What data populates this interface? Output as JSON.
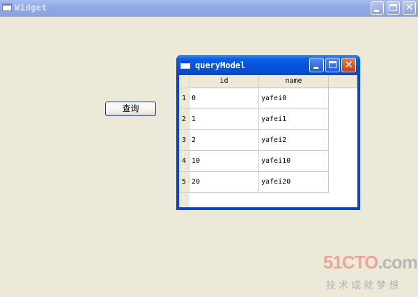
{
  "main_window": {
    "title": "Widget",
    "buttons": {
      "minimize": "",
      "maximize": "",
      "close": "✕"
    }
  },
  "query_button": {
    "label": "查询"
  },
  "child_window": {
    "title": "queryModel",
    "buttons": {
      "minimize": "",
      "maximize": "",
      "close": "✕"
    },
    "table": {
      "columns": [
        "id",
        "name"
      ],
      "rows": [
        {
          "header": "1",
          "id": "0",
          "name": "yafei0"
        },
        {
          "header": "2",
          "id": "1",
          "name": "yafei1"
        },
        {
          "header": "3",
          "id": "2",
          "name": "yafei2"
        },
        {
          "header": "4",
          "id": "10",
          "name": "yafei10"
        },
        {
          "header": "5",
          "id": "20",
          "name": "yafei20"
        }
      ]
    }
  },
  "watermark": {
    "logo": "51CTO",
    "logo_suffix": ".com",
    "tagline": "技术成就梦想"
  },
  "colors": {
    "desktop": "#ece9d8",
    "active_titlebar": "#0453d9",
    "inactive_titlebar": "#92a9e6",
    "close_button": "#c33f18"
  }
}
